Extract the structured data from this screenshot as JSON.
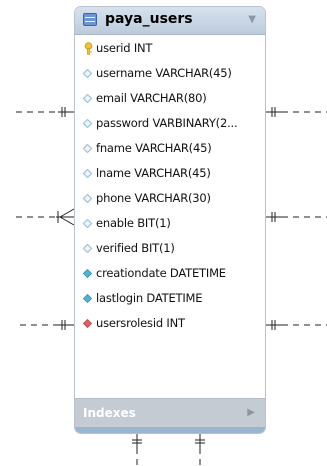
{
  "table": {
    "name": "paya_users",
    "columns": [
      {
        "label": "userid INT",
        "icon": "primary-key-icon"
      },
      {
        "label": "username VARCHAR(45)",
        "icon": "column-diamond-icon"
      },
      {
        "label": "email VARCHAR(80)",
        "icon": "column-diamond-icon"
      },
      {
        "label": "password VARBINARY(2...",
        "icon": "column-diamond-icon"
      },
      {
        "label": "fname VARCHAR(45)",
        "icon": "column-diamond-icon"
      },
      {
        "label": "lname VARCHAR(45)",
        "icon": "column-diamond-icon"
      },
      {
        "label": "phone VARCHAR(30)",
        "icon": "column-diamond-icon"
      },
      {
        "label": "enable BIT(1)",
        "icon": "column-diamond-icon"
      },
      {
        "label": "verified BIT(1)",
        "icon": "column-diamond-icon"
      },
      {
        "label": "creationdate DATETIME",
        "icon": "column-diamond-filled-icon"
      },
      {
        "label": "lastlogin DATETIME",
        "icon": "column-diamond-filled-icon"
      },
      {
        "label": "usersrolesid INT",
        "icon": "foreign-key-diamond-icon"
      }
    ],
    "indexes_label": "Indexes"
  },
  "colors": {
    "header": "#c9d6e4",
    "key": "#f2c12e",
    "diamond_hollow": "#9ec3d3",
    "diamond_filled": "#4eb4d6",
    "foreign_key": "#d9636a",
    "indexes_bg": "#c4cbd3",
    "connector": "#222222"
  }
}
